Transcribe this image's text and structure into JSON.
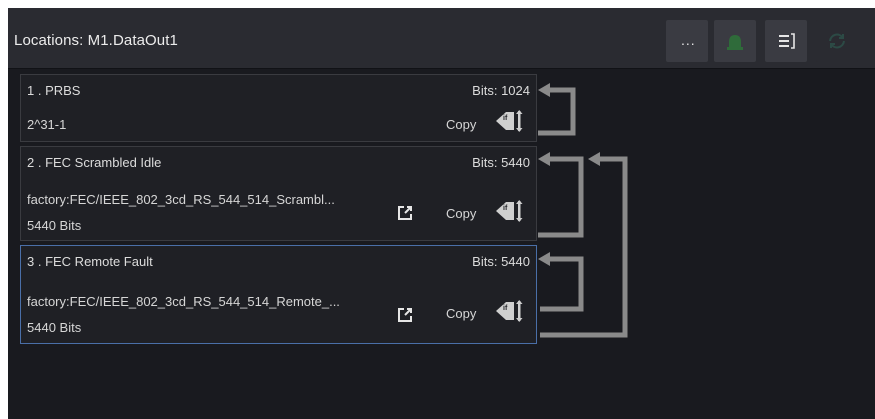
{
  "header": {
    "title": "Locations: M1.DataOut1",
    "more_label": "...",
    "buttons": [
      "more-button",
      "bell-button",
      "document-button",
      "sync-button"
    ]
  },
  "items": [
    {
      "title": "1 . PRBS",
      "bits": "Bits: 1024",
      "value": "2^31-1",
      "copy": "Copy"
    },
    {
      "title": "2 . FEC Scrambled Idle",
      "bits": "Bits: 5440",
      "path": "factory:FEC/IEEE_802_3cd_RS_544_514_Scrambl...",
      "size": "5440 Bits",
      "copy": "Copy"
    },
    {
      "title": "3 . FEC Remote Fault",
      "bits": "Bits: 5440",
      "path": "factory:FEC/IEEE_802_3cd_RS_544_514_Remote_...",
      "size": "5440 Bits",
      "copy": "Copy"
    }
  ],
  "icons": {
    "more": "ellipsis-icon",
    "bell": "bell-icon",
    "doc": "document-icon",
    "sync": "sync-icon",
    "external": "open-external-icon",
    "if_tag": "if-tag-icon",
    "loop_arrow": "loop-arrow-icon"
  },
  "colors": {
    "panel_bg": "#191a1f",
    "header_bg": "#2a2b31",
    "card_bg": "#1f2025",
    "card_border": "#3a3b40",
    "selected_border": "#4a6fa8",
    "arrow": "#8a8a8a",
    "bell_green": "#2f6b3a",
    "sync_green": "#2c4a45"
  }
}
